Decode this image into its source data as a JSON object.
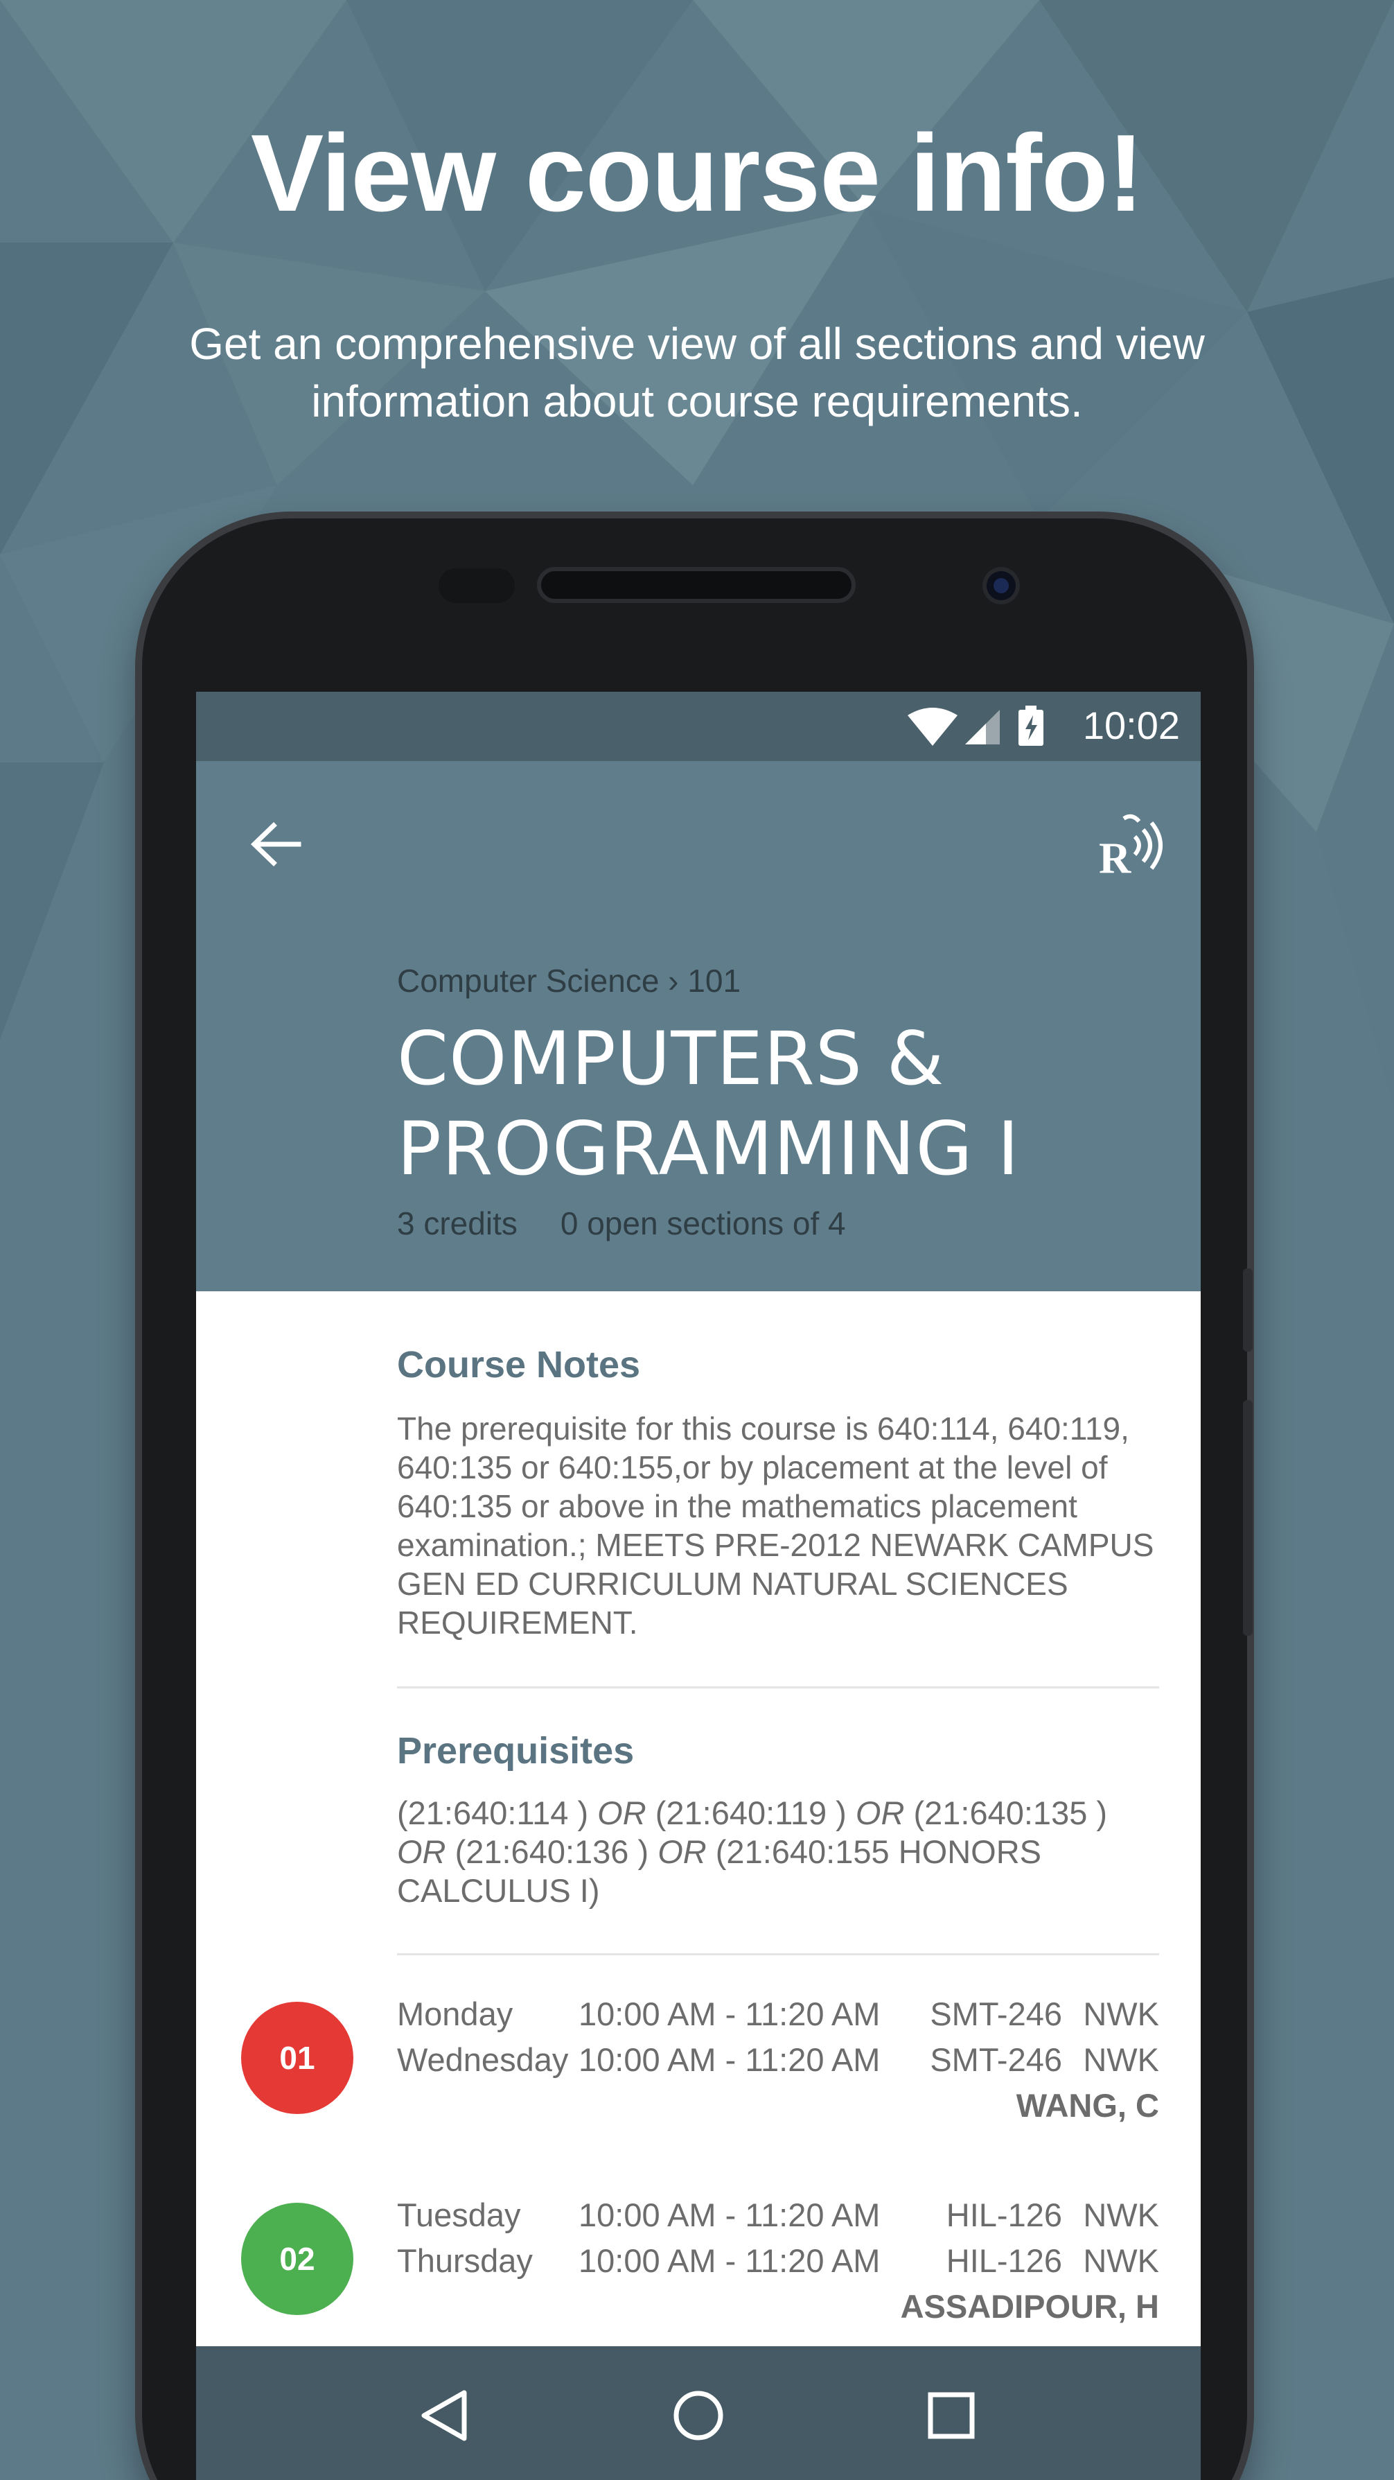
{
  "promo": {
    "title": "View course info!",
    "subtitle": "Get an comprehensive view of all sections and view information about course requirements."
  },
  "status_bar": {
    "time": "10:02",
    "icons": [
      "wifi-icon",
      "cellular-signal-icon",
      "battery-charging-icon"
    ]
  },
  "app_bar": {
    "back_icon": "arrow-back-icon",
    "logo_icon": "rutgers-logo-icon"
  },
  "course": {
    "breadcrumb": "Computer Science › 101",
    "title": "COMPUTERS & PROGRAMMING I",
    "credits": "3 credits",
    "open_sections": "0 open sections of 4"
  },
  "notes": {
    "heading": "Course Notes",
    "body": "The prerequisite for this course is 640:114, 640:119, 640:135 or 640:155,or by placement at the level of 640:135 or above in the mathematics placement examination.; MEETS PRE-2012 NEWARK CAMPUS GEN ED CURRICULUM NATURAL SCIENCES REQUIREMENT."
  },
  "prerequisites": {
    "heading": "Prerequisites",
    "parts": [
      {
        "text": "(21:640:114 )",
        "italic": false
      },
      {
        "text": " OR ",
        "italic": true
      },
      {
        "text": "(21:640:119 )",
        "italic": false
      },
      {
        "text": " OR ",
        "italic": true
      },
      {
        "text": "(21:640:135 )",
        "italic": false
      },
      {
        "text": " OR ",
        "italic": true
      },
      {
        "text": "(21:640:136 )",
        "italic": false
      },
      {
        "text": " OR ",
        "italic": true
      },
      {
        "text": "(21:640:155 HONORS CALCULUS I)",
        "italic": false
      }
    ]
  },
  "sections": [
    {
      "number": "01",
      "color": "#e53935",
      "meetings": [
        {
          "day": "Monday",
          "time": "10:00 AM - 11:20 AM",
          "room": "SMT-246",
          "campus": "NWK"
        },
        {
          "day": "Wednesday",
          "time": "10:00 AM - 11:20 AM",
          "room": "SMT-246",
          "campus": "NWK"
        }
      ],
      "instructor": "WANG, C"
    },
    {
      "number": "02",
      "color": "#4caf50",
      "meetings": [
        {
          "day": "Tuesday",
          "time": "10:00 AM - 11:20 AM",
          "room": "HIL-126",
          "campus": "NWK"
        },
        {
          "day": "Thursday",
          "time": "10:00 AM - 11:20 AM",
          "room": "HIL-126",
          "campus": "NWK"
        }
      ],
      "instructor": "ASSADIPOUR, H"
    }
  ],
  "nav_bar": {
    "icons": [
      "back-triangle-icon",
      "home-circle-icon",
      "recents-square-icon"
    ]
  },
  "colors": {
    "background": "#5d7a88",
    "app_bar": "#607d8b",
    "status_bar": "#4a606b",
    "nav_bar": "#455a64",
    "heading": "#5a7482"
  }
}
